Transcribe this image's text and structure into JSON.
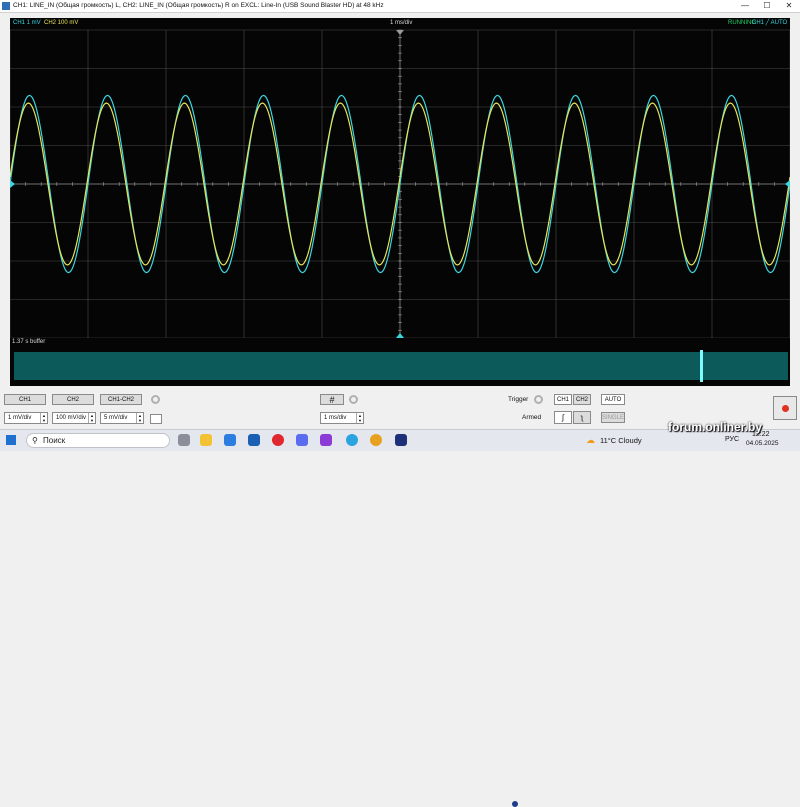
{
  "window": {
    "title": "CH1: LINE_IN (Общая громкость) L, CH2: LINE_IN (Общая громкость) R on EXCL: Line-In (USB Sound Blaster HD) at 48 kHz",
    "minimize": "—",
    "maximize": "☐",
    "close": "✕"
  },
  "scope": {
    "ch1_label": "CH1 1 mV",
    "ch2_label": "CH2 100 mV",
    "timebase_label": "1 ms/div",
    "state": "RUNNING",
    "trigger_info": "CH1 ╱ AUTO",
    "colors": {
      "ch1": "#3ad6e0",
      "ch2": "#e6e35a",
      "status": "#22d46a",
      "grid": "#4a4a4a"
    }
  },
  "buffer": {
    "label": "1.37 s buffer"
  },
  "controls": {
    "ch1_button": "CH1",
    "ch2_button": "CH2",
    "ch1_ch2_button": "CH1-CH2",
    "ch1_scale": "1 mV/div",
    "ch2_scale": "100 mV/div",
    "math_scale": "5 mV/div",
    "timebase": "1 ms/div",
    "trigger_label": "Trigger",
    "trigger_ch1": "CH1",
    "trigger_ch2": "CH2",
    "auto_button": "AUTO",
    "armed_label": "Armed",
    "single_button": "SINGLE"
  },
  "taskbar": {
    "search_placeholder": "Поиск",
    "weather": "11°C  Cloudy",
    "language": "РУС",
    "time": "12:22",
    "date": "04.05.2025"
  },
  "watermark": "forum.onliner.by",
  "chart_data": {
    "type": "line",
    "title": "",
    "xlabel": "1 ms/div",
    "ylabel": "",
    "divisions": {
      "x": 10,
      "y": 8
    },
    "xlim_ms": [
      -5,
      5
    ],
    "ylim_div": [
      -4,
      4
    ],
    "series": [
      {
        "name": "CH1 1 mV",
        "color": "#3ad6e0",
        "frequency_hz": 1000,
        "amplitude_div": 2.3,
        "phase_deg": 0
      },
      {
        "name": "CH2 100 mV",
        "color": "#e6e35a",
        "frequency_hz": 1000,
        "amplitude_div": 2.1,
        "phase_deg": 5
      }
    ],
    "trigger_level_div": 0,
    "grid": true
  }
}
